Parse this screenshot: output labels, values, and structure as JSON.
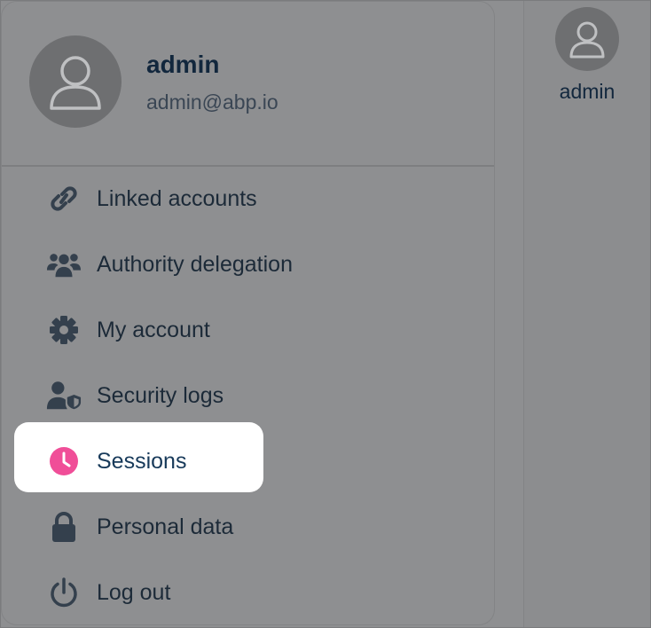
{
  "header": {
    "user_name": "admin"
  },
  "profile": {
    "name": "admin",
    "email": "admin@abp.io"
  },
  "menu": {
    "items": [
      {
        "label": "Linked accounts",
        "icon": "link-icon"
      },
      {
        "label": "Authority delegation",
        "icon": "users-icon"
      },
      {
        "label": "My account",
        "icon": "gear-icon"
      },
      {
        "label": "Security logs",
        "icon": "user-shield-icon"
      },
      {
        "label": "Sessions",
        "icon": "clock-icon",
        "active": true
      },
      {
        "label": "Personal data",
        "icon": "lock-icon"
      },
      {
        "label": "Log out",
        "icon": "power-icon"
      }
    ]
  },
  "colors": {
    "accent": "#f04e98",
    "text": "#1c2a38",
    "overlay": "#8e8f91",
    "highlight": "#ffffff"
  }
}
